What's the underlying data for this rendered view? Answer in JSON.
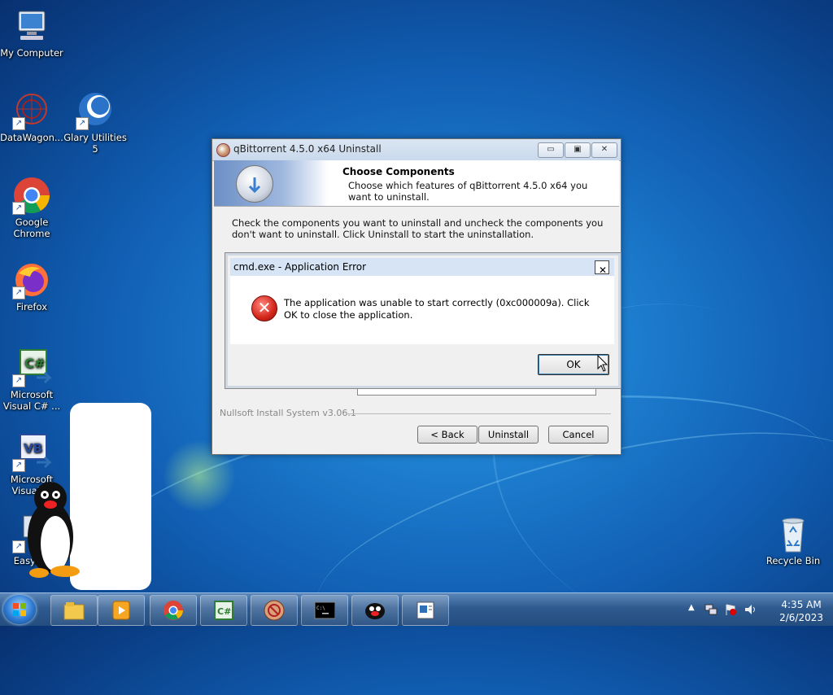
{
  "desktop": {
    "icons": [
      {
        "label": "My Computer",
        "icon": "computer-icon"
      },
      {
        "label": "DataWagon...",
        "icon": "datawagon-icon"
      },
      {
        "label": "Glary Utilities 5",
        "icon": "glary-utilities-icon"
      },
      {
        "label": "Google Chrome",
        "icon": "chrome-icon"
      },
      {
        "label": "Firefox",
        "icon": "firefox-icon"
      },
      {
        "label": "Microsoft Visual C# ...",
        "icon": "visual-csharp-icon"
      },
      {
        "label": "Microsoft Visual ...",
        "icon": "visual-basic-icon"
      },
      {
        "label": "EasyL...",
        "icon": "easy-icon"
      },
      {
        "label": "Recycle Bin",
        "icon": "recycle-bin-icon"
      }
    ]
  },
  "installer": {
    "title": "qBittorrent 4.5.0 x64 Uninstall",
    "header_title": "Choose Components",
    "header_subtitle": "Choose which features of qBittorrent 4.5.0 x64 you want to uninstall.",
    "instructions": "Check the components you want to uninstall and uncheck the components you don't want to uninstall. Click Uninstall to start the uninstallation.",
    "branding": "Nullsoft Install System v3.06.1",
    "back_label": "< Back",
    "uninstall_label": "Uninstall",
    "cancel_label": "Cancel"
  },
  "error_dialog": {
    "title": "cmd.exe - Application Error",
    "message": "The application was unable to start correctly (0xc000009a). Click OK to close the application.",
    "ok_label": "OK",
    "close_glyph": "✕",
    "icon": "error-icon"
  },
  "taskbar": {
    "items": [
      "start-orb",
      "explorer-icon",
      "media-player-icon",
      "chrome-icon",
      "visual-csharp-icon",
      "qbittorrent-icon",
      "cmd-icon",
      "pingu-icon",
      "document-icon"
    ],
    "time": "4:35 AM",
    "date": "2/6/2023"
  }
}
